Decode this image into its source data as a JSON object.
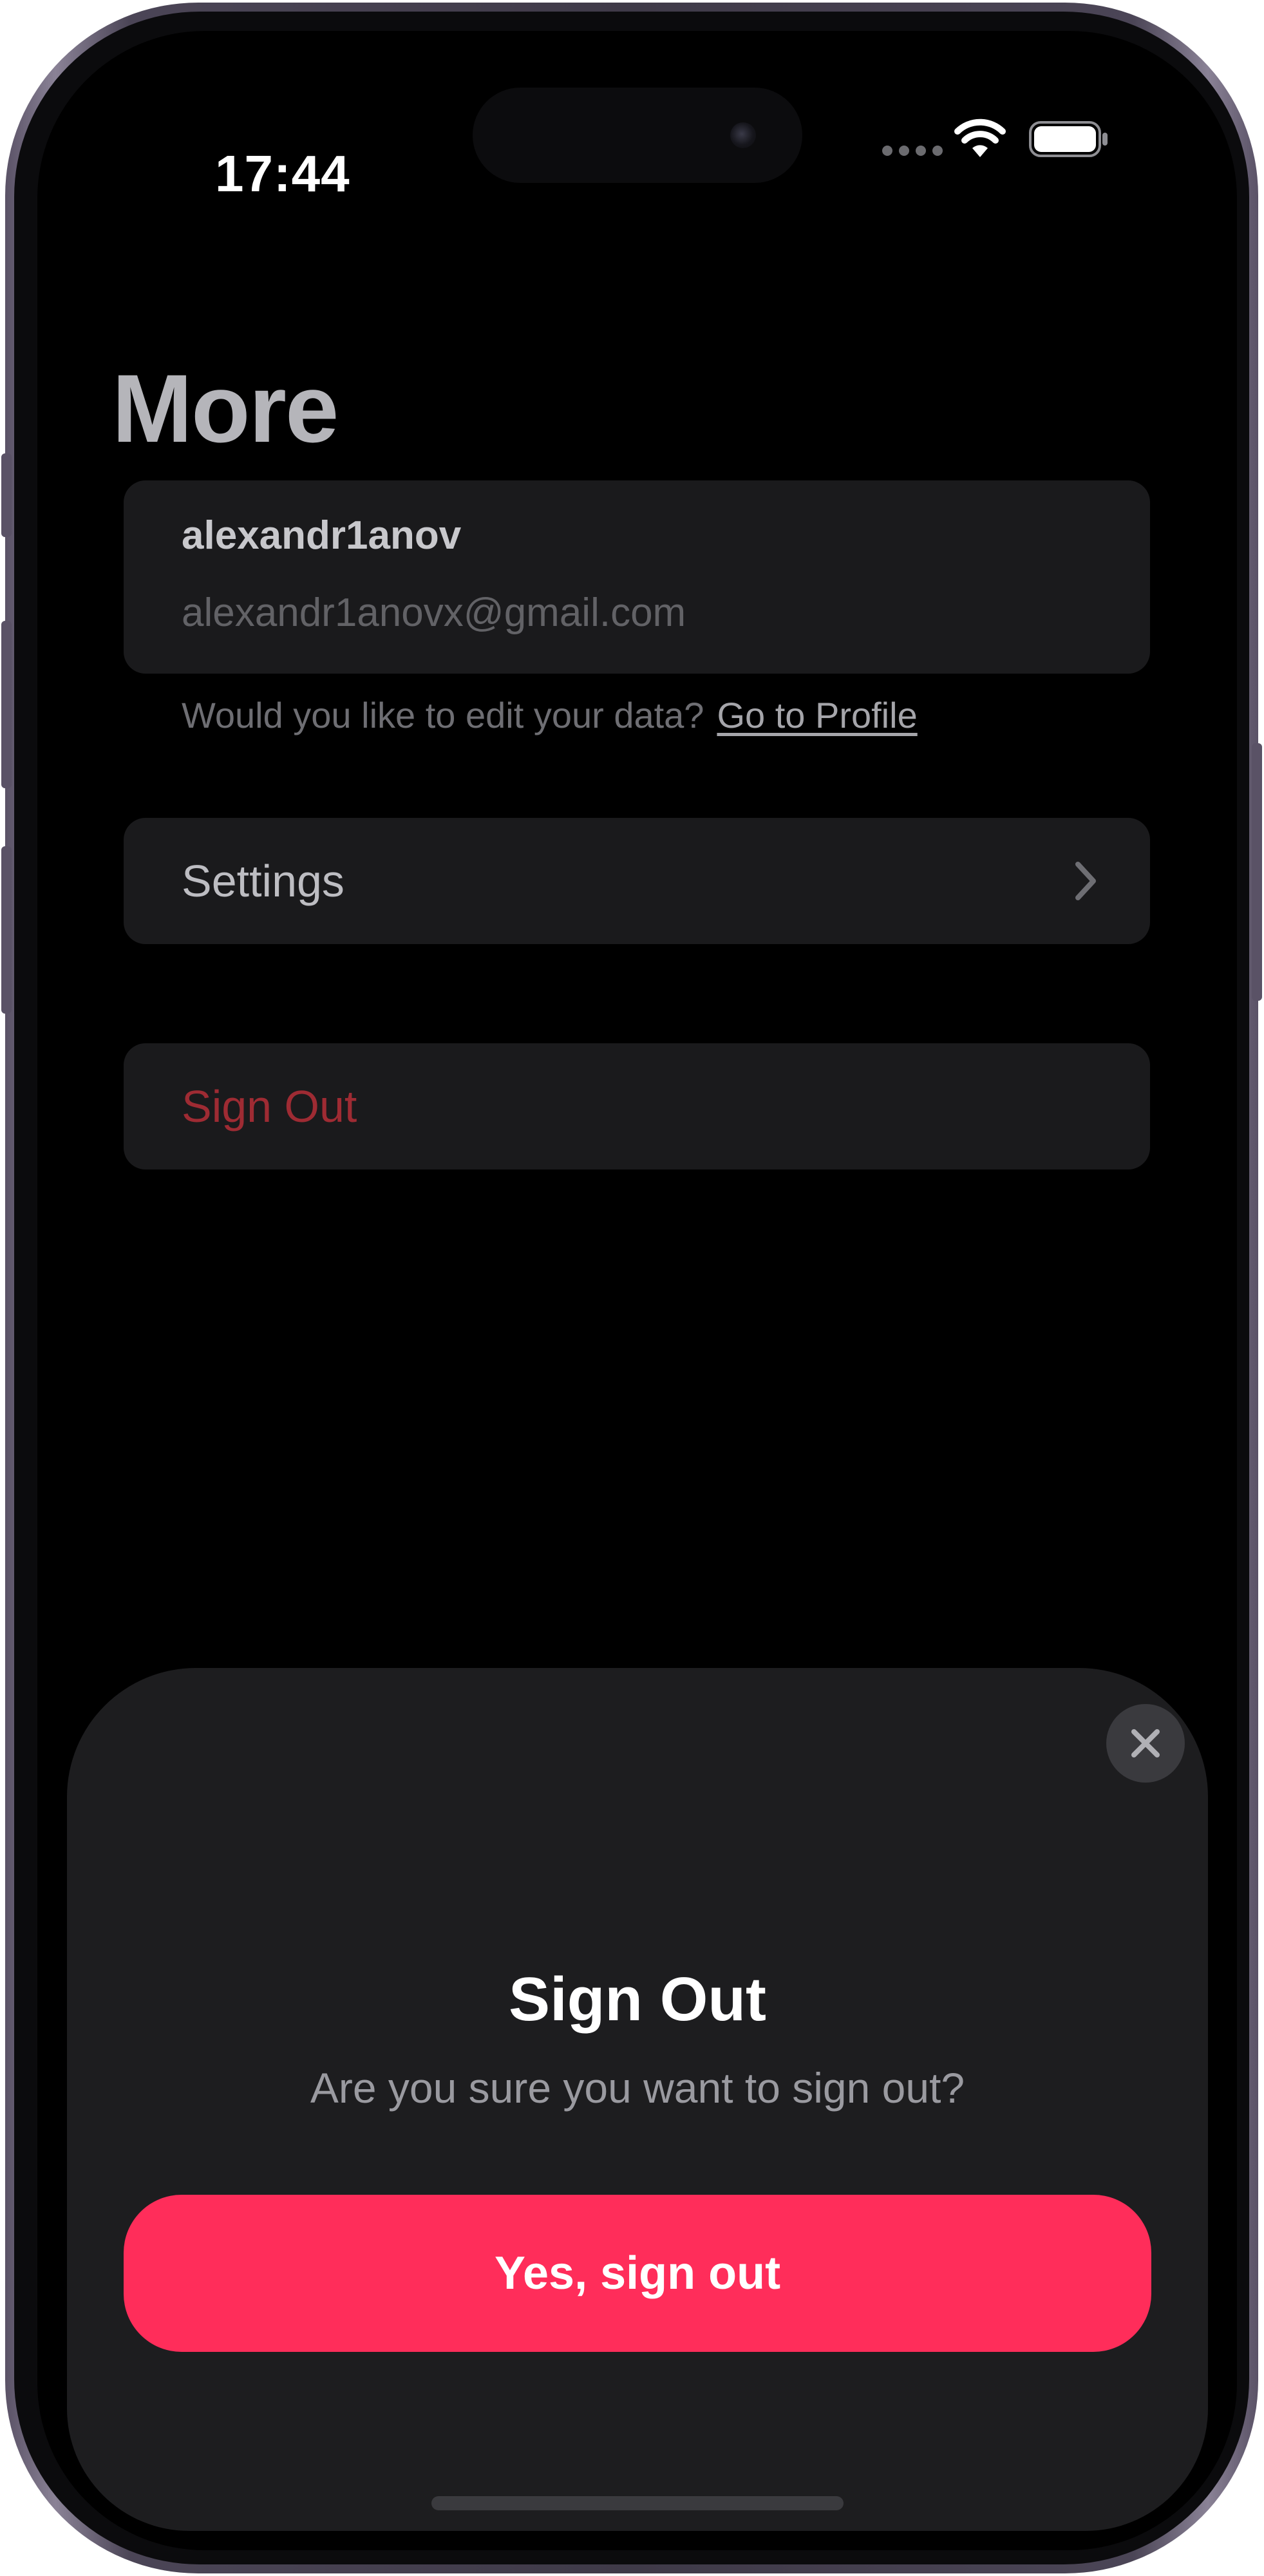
{
  "status_bar": {
    "time": "17:44",
    "icons": [
      "cellular-dots-icon",
      "wifi-icon",
      "battery-icon"
    ]
  },
  "page": {
    "title": "More"
  },
  "profile": {
    "username": "alexandr1anov",
    "email": "alexandr1anovx@gmail.com",
    "edit_prompt": "Would you like to edit your data?",
    "edit_link": "Go to Profile"
  },
  "menu": {
    "settings_label": "Settings",
    "settings_icon": "chevron-right-icon",
    "sign_out_label": "Sign Out"
  },
  "sheet": {
    "title": "Sign Out",
    "message": "Are you sure you want to sign out?",
    "confirm_label": "Yes, sign out",
    "close_icon": "close-icon"
  },
  "colors": {
    "background": "#000000",
    "card": "#1a1a1c",
    "sheet": "#1d1d1f",
    "destructive_text": "#9e2b33",
    "accent": "#ff2d5a"
  }
}
